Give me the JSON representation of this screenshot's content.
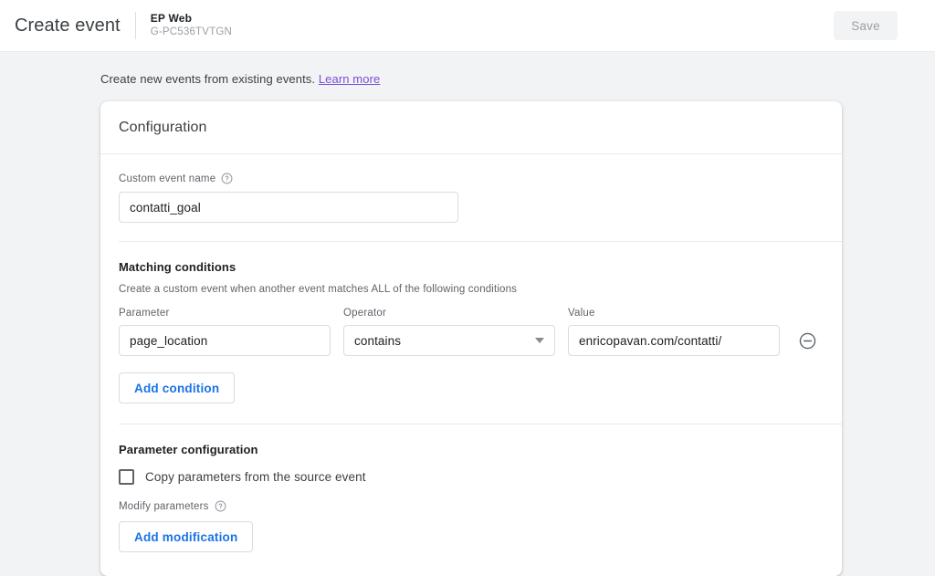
{
  "topbar": {
    "title": "Create event",
    "property_name": "EP Web",
    "property_id": "G-PC536TVTGN",
    "save_label": "Save",
    "save_disabled": true
  },
  "notice": {
    "text": "Create new events from existing events.",
    "link_label": "Learn more",
    "link_color": "#7b4ed9"
  },
  "card": {
    "header": "Configuration",
    "event_name": {
      "label": "Custom event name",
      "help_icon": "help-circle-icon",
      "value": "contatti_goal",
      "placeholder": ""
    },
    "matching": {
      "title": "Matching conditions",
      "subtitle": "Create a custom event when another event matches ALL of the following conditions",
      "columns": {
        "parameter": "Parameter",
        "operator": "Operator",
        "value": "Value"
      },
      "conditions": [
        {
          "parameter": "page_location",
          "operator": "contains",
          "value": "enricopavan.com/contatti/",
          "remove_icon": "remove-circle-icon"
        }
      ],
      "add_condition_label": "Add condition"
    },
    "parameter_config": {
      "title": "Parameter configuration",
      "copy_params_label": "Copy parameters from the source event",
      "copy_params_checked": false,
      "modify_label": "Modify parameters",
      "modify_help_icon": "help-circle-icon",
      "add_modification_label": "Add modification"
    }
  },
  "colors": {
    "accent_blue": "#1a73e8",
    "page_bg": "#f1f3f4",
    "card_bg": "#ffffff",
    "border": "#dadce0"
  }
}
